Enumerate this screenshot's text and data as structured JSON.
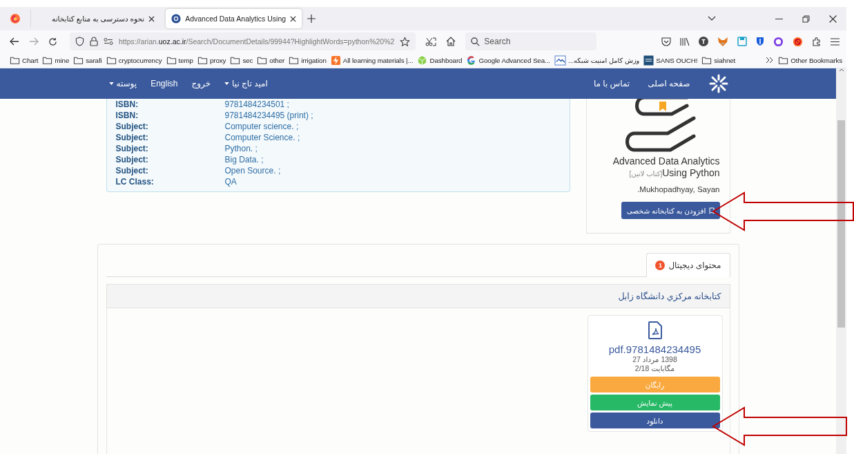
{
  "browser": {
    "tabs": [
      {
        "title": "نحوه دسترسی به منابع کتابخانه",
        "selected": false
      },
      {
        "title": "Advanced Data Analytics Using",
        "selected": true
      }
    ],
    "url": "https://arian.**uoz.ac.ir**/Search/DocumentDetails/99944?HighlightWords=python%20%2",
    "search_placeholder": "Search",
    "bookmarks": [
      {
        "label": "Chart",
        "kind": "folder"
      },
      {
        "label": "mine",
        "kind": "folder"
      },
      {
        "label": "sarafi",
        "kind": "folder"
      },
      {
        "label": "cryptocurrency",
        "kind": "folder"
      },
      {
        "label": "temp",
        "kind": "folder"
      },
      {
        "label": "proxy",
        "kind": "folder"
      },
      {
        "label": "sec",
        "kind": "folder"
      },
      {
        "label": "other",
        "kind": "folder"
      },
      {
        "label": "irrigation",
        "kind": "folder"
      },
      {
        "label": "All learning materials |...",
        "kind": "bolt"
      },
      {
        "label": "Dashboard",
        "kind": "cube"
      },
      {
        "label": "Google Advanced Sea...",
        "kind": "google"
      },
      {
        "label": "...وزش کامل امنیت شبکه",
        "kind": "picture"
      },
      {
        "label": "SANS OUCH!",
        "kind": "sans"
      },
      {
        "label": "siahnet",
        "kind": "folder"
      }
    ],
    "other_bookmarks": "Other Bookmarks"
  },
  "navbar": {
    "site_links": [
      {
        "label": "صفحه اصلی"
      },
      {
        "label": "تماس با ما"
      }
    ],
    "user_links": [
      {
        "label": "امید تاج نیا",
        "dropdown": true
      },
      {
        "label": "خروج",
        "dropdown": false
      },
      {
        "label": "English",
        "dropdown": false
      },
      {
        "label": "پوسته",
        "dropdown": true
      }
    ]
  },
  "metadata": [
    {
      "label": "ISBN:",
      "value": "9781484234501 ;"
    },
    {
      "label": "ISBN:",
      "value": "9781484234495 (print) ;"
    },
    {
      "label": "Subject:",
      "value": "Computer science. ;"
    },
    {
      "label": "Subject:",
      "value": "Computer Science. ;"
    },
    {
      "label": "Subject:",
      "value": "Python. ;"
    },
    {
      "label": "Subject:",
      "value": "Big Data. ;"
    },
    {
      "label": "Subject:",
      "value": "Open Source. ;"
    },
    {
      "label": "LC Class:",
      "value": "QA"
    }
  ],
  "book": {
    "title": "Advanced Data Analytics Using Python",
    "type_tag": "[کتاب لاتین]",
    "author": ".Mukhopadhyay, Sayan",
    "add_button": "افزودن به کتابخانه شخصی"
  },
  "digital": {
    "tabs": [
      {
        "label": "محتوای دیجیتال",
        "badge": "1",
        "selected": true
      }
    ],
    "library": "کتابخانه مرکزي دانشگاه زابل",
    "file": {
      "name": "pdf.9781484234495",
      "date": "1398 مرداد 27",
      "size": "مگابایت 2/18",
      "buttons": [
        {
          "label": "رایگان",
          "kind": "price"
        },
        {
          "label": "پیش نمایش",
          "kind": "preview"
        },
        {
          "label": "دانلود",
          "kind": "download"
        }
      ]
    }
  }
}
